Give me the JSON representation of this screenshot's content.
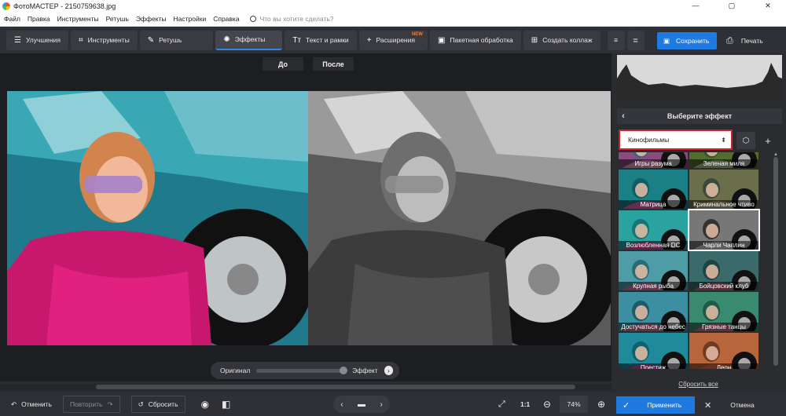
{
  "window": {
    "title": "ФотоМАСТЕР - 2150759638.jpg",
    "minimize": "—",
    "maximize": "▢",
    "close": "✕"
  },
  "menu": {
    "items": [
      "Файл",
      "Правка",
      "Инструменты",
      "Ретушь",
      "Эффекты",
      "Настройки",
      "Справка"
    ],
    "search_placeholder": "Что вы хотите сделать?"
  },
  "toolbar": {
    "tabs": [
      {
        "label": "Улучшения",
        "icon": "sliders-icon"
      },
      {
        "label": "Инструменты",
        "icon": "crop-icon"
      },
      {
        "label": "Ретушь",
        "icon": "brush-icon"
      },
      {
        "label": "Эффекты",
        "icon": "sparkle-icon"
      },
      {
        "label": "Текст и рамки",
        "icon": "text-icon"
      },
      {
        "label": "Расширения",
        "icon": "plus-icon",
        "badge": "NEW"
      },
      {
        "label": "Пакетная обработка",
        "icon": "images-icon"
      },
      {
        "label": "Создать коллаж",
        "icon": "collage-icon"
      }
    ],
    "save_label": "Сохранить",
    "print_label": "Печать"
  },
  "preview": {
    "before_label": "До",
    "after_label": "После"
  },
  "compare": {
    "original_label": "Оригинал",
    "effect_label": "Эффект"
  },
  "panel": {
    "title": "Выберите эффект",
    "category": "Кинофильмы",
    "effects": [
      "Игры разума",
      "Зеленая миля",
      "Матрица",
      "Криминальное чтиво",
      "Возлюбленная DC",
      "Чарли Чаплин",
      "Крупная рыба",
      "Бойцовский клуб",
      "Достучаться до небес",
      "Грязные танцы",
      "Престиж",
      "Леон"
    ],
    "selected": "Чарли Чаплин",
    "reset_all": "Сбросить все"
  },
  "bottombar": {
    "undo": "Отменить",
    "redo": "Повторить",
    "reset": "Сбросить",
    "ratio": "1:1",
    "zoom": "74%",
    "apply": "Применить",
    "cancel": "Отмена"
  },
  "colors": {
    "accent": "#1e7ae0",
    "highlight": "#d0202a"
  }
}
